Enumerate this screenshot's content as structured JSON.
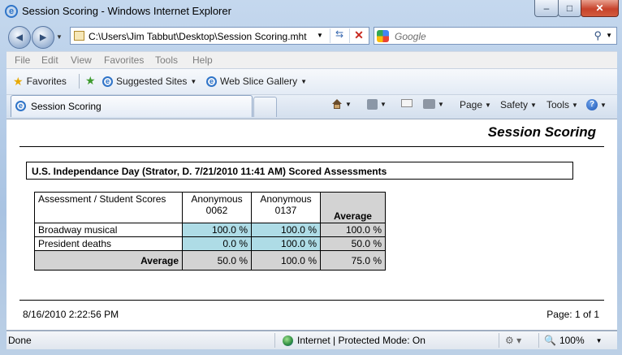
{
  "window": {
    "title": "Session Scoring - Windows Internet Explorer",
    "minimize": "–",
    "maximize": "□",
    "close": "✕"
  },
  "address_bar": {
    "url": "C:\\Users\\Jim Tabbut\\Desktop\\Session Scoring.mht",
    "back_icon": "◀",
    "forward_icon": "▶"
  },
  "search": {
    "placeholder": "Google"
  },
  "menu": {
    "items": [
      "File",
      "Edit",
      "View",
      "Favorites",
      "Tools",
      "Help"
    ]
  },
  "favorites_bar": {
    "favorites_label": "Favorites",
    "suggested_sites": "Suggested Sites",
    "web_slice_gallery": "Web Slice Gallery"
  },
  "tab": {
    "label": "Session Scoring"
  },
  "command_bar": {
    "page": "Page",
    "safety": "Safety",
    "tools": "Tools",
    "help": "?"
  },
  "report": {
    "title": "Session Scoring",
    "session_heading": "U.S. Independance Day (Strator, D. 7/21/2010 11:41 AM) Scored Assessments",
    "table": {
      "corner_header": "Assessment / Student Scores",
      "students": [
        {
          "line1": "Anonymous",
          "line2": "0062"
        },
        {
          "line1": "Anonymous",
          "line2": "0137"
        }
      ],
      "average_header": "Average",
      "rows": [
        {
          "assessment": "Broadway musical",
          "scores": [
            "100.0 %",
            "100.0 %"
          ],
          "average": "100.0 %"
        },
        {
          "assessment": "President deaths",
          "scores": [
            "0.0 %",
            "100.0 %"
          ],
          "average": "50.0 %"
        }
      ],
      "footer": {
        "label": "Average",
        "scores": [
          "50.0 %",
          "100.0 %"
        ],
        "overall": "75.0 %"
      }
    },
    "printed_at": "8/16/2010 2:22:56 PM",
    "page_number": "Page: 1 of 1"
  },
  "status_bar": {
    "status": "Done",
    "zone": "Internet | Protected Mode: On",
    "zoom": "100%"
  }
}
